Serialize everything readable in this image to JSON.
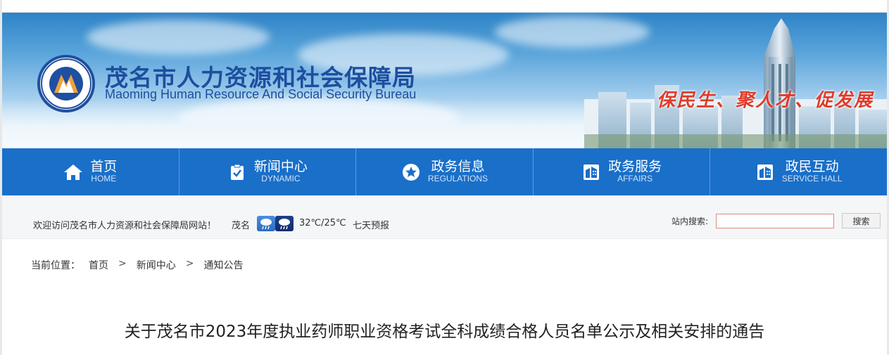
{
  "header": {
    "title_cn": "茂名市人力资源和社会保障局",
    "title_en": "Maoming Human Resource And Social Security Bureau",
    "slogan": "保民生、聚人才、促发展",
    "logo_icon": "bureau-emblem-icon"
  },
  "nav": {
    "items": [
      {
        "cn": "首页",
        "en": "HOME",
        "icon": "home-icon"
      },
      {
        "cn": "新闻中心",
        "en": "DYNAMIC",
        "icon": "clipboard-check-icon"
      },
      {
        "cn": "政务信息",
        "en": "REGULATIONS",
        "icon": "star-icon"
      },
      {
        "cn": "政务服务",
        "en": "AFFAIRS",
        "icon": "building-icon"
      },
      {
        "cn": "政民互动",
        "en": "SERVICE HALL",
        "icon": "building-icon"
      }
    ],
    "bg_color": "#1a6fc9"
  },
  "infobar": {
    "welcome": "欢迎访问茂名市人力资源和社会保障局网站！",
    "city": "茂名",
    "weather_icons": [
      "rain-day-icon",
      "rain-night-icon"
    ],
    "temperature": "32℃/25℃",
    "forecast_link": "七天预报",
    "search_label": "站内搜索:",
    "search_value": "",
    "search_button": "搜索"
  },
  "breadcrumb": {
    "label": "当前位置：",
    "items": [
      "首页",
      "新闻中心",
      "通知公告"
    ],
    "separator": ">"
  },
  "article": {
    "title": "关于茂名市2023年度执业药师职业资格考试全科成绩合格人员名单公示及相关安排的通告"
  }
}
